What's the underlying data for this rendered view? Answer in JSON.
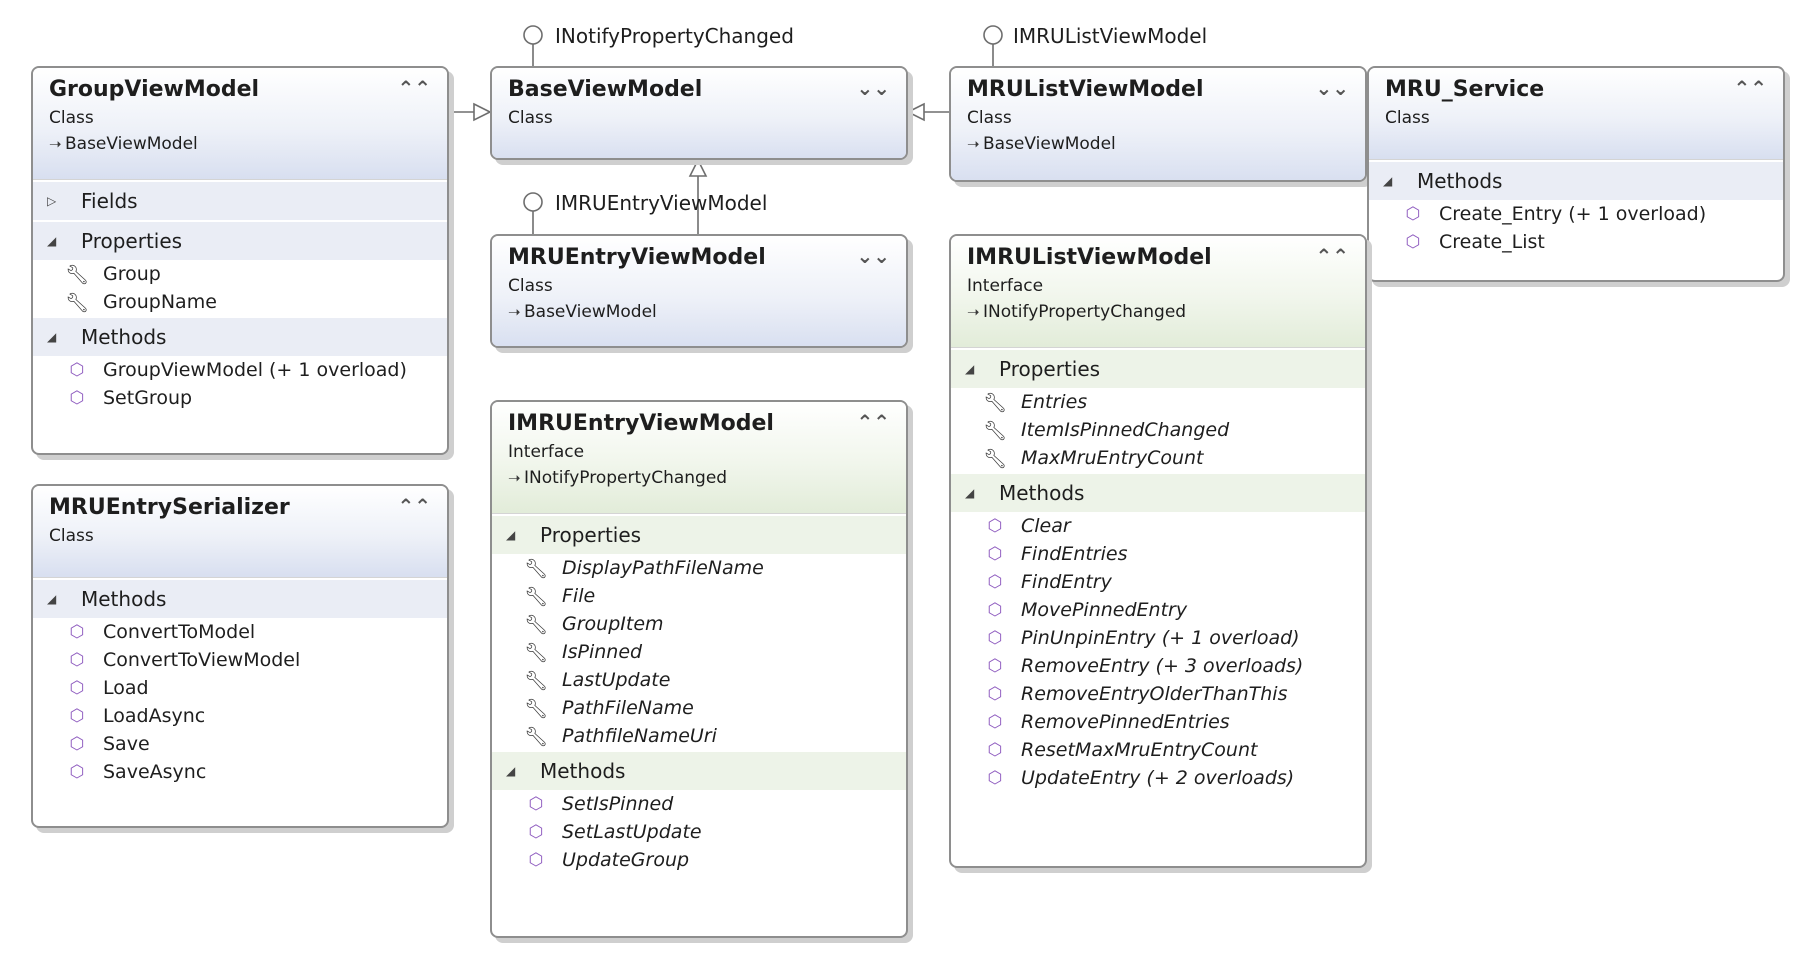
{
  "interface_labels": {
    "inotify": "INotifyPropertyChanged",
    "imrulist": "IMRUListViewModel",
    "imruentry": "IMRUEntryViewModel"
  },
  "boxes": {
    "group_vm": {
      "name": "GroupViewModel",
      "kind": "Class",
      "base": "BaseViewModel",
      "fields_label": "Fields",
      "properties_label": "Properties",
      "properties": [
        "Group",
        "GroupName"
      ],
      "methods_label": "Methods",
      "methods": [
        "GroupViewModel (+ 1 overload)",
        "SetGroup"
      ]
    },
    "base_vm": {
      "name": "BaseViewModel",
      "kind": "Class"
    },
    "mrulist_vm": {
      "name": "MRUListViewModel",
      "kind": "Class",
      "base": "BaseViewModel"
    },
    "mru_service": {
      "name": "MRU_Service",
      "kind": "Class",
      "methods_label": "Methods",
      "methods": [
        "Create_Entry (+ 1 overload)",
        "Create_List"
      ]
    },
    "mruentry_vm": {
      "name": "MRUEntryViewModel",
      "kind": "Class",
      "base": "BaseViewModel"
    },
    "imrulist_vm": {
      "name": "IMRUListViewModel",
      "kind": "Interface",
      "base": "INotifyPropertyChanged",
      "properties_label": "Properties",
      "properties": [
        "Entries",
        "ItemIsPinnedChanged",
        "MaxMruEntryCount"
      ],
      "methods_label": "Methods",
      "methods": [
        "Clear",
        "FindEntries",
        "FindEntry",
        "MovePinnedEntry",
        "PinUnpinEntry (+ 1 overload)",
        "RemoveEntry (+ 3 overloads)",
        "RemoveEntryOlderThanThis",
        "RemovePinnedEntries",
        "ResetMaxMruEntryCount",
        "UpdateEntry (+ 2 overloads)"
      ]
    },
    "serializer": {
      "name": "MRUEntrySerializer",
      "kind": "Class",
      "methods_label": "Methods",
      "methods": [
        "ConvertToModel",
        "ConvertToViewModel",
        "Load",
        "LoadAsync",
        "Save",
        "SaveAsync"
      ]
    },
    "imruentry_vm": {
      "name": "IMRUEntryViewModel",
      "kind": "Interface",
      "base": "INotifyPropertyChanged",
      "properties_label": "Properties",
      "properties": [
        "DisplayPathFileName",
        "File",
        "GroupItem",
        "IsPinned",
        "LastUpdate",
        "PathFileName",
        "PathfileNameUri"
      ],
      "methods_label": "Methods",
      "methods": [
        "SetIsPinned",
        "SetLastUpdate",
        "UpdateGroup"
      ]
    }
  },
  "glyphs": {
    "collapse": "⌃⌃",
    "expand": "⌄⌄",
    "base_arrow": "➝",
    "section_expanded": "◢",
    "section_collapsed": "▷",
    "property_icon": "wrench-icon",
    "method_icon": "cube-icon"
  }
}
